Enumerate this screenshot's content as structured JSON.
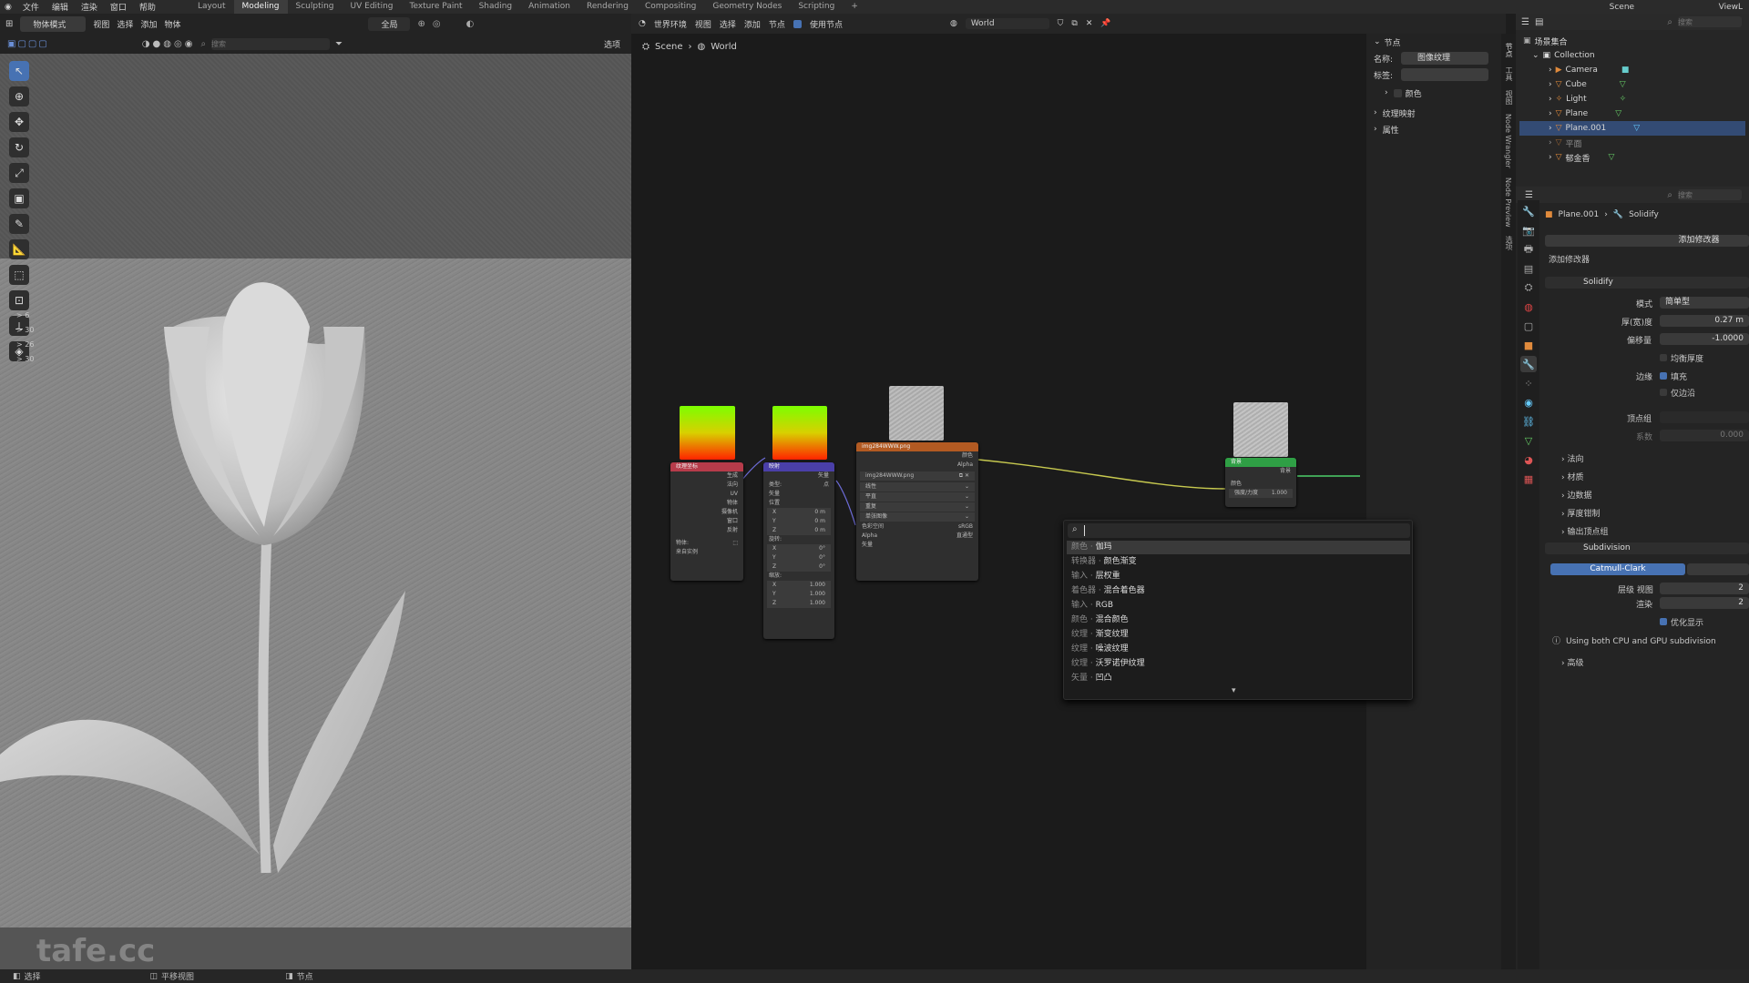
{
  "topbar": {
    "menus": [
      "文件",
      "编辑",
      "渲染",
      "窗口",
      "帮助"
    ],
    "workspaces": [
      "Layout",
      "Modeling",
      "Sculpting",
      "UV Editing",
      "Texture Paint",
      "Shading",
      "Animation",
      "Rendering",
      "Compositing",
      "Geometry Nodes",
      "Scripting"
    ],
    "active_workspace": "Modeling",
    "add_tab": "+",
    "scene_label": "Scene",
    "viewlayer_label": "ViewL"
  },
  "viewport": {
    "mode": "物体模式",
    "menus": [
      "视图",
      "选择",
      "添加",
      "物体"
    ],
    "search_placeholder": "搜索",
    "transform": "全局",
    "options": "选项",
    "collection_rows": [
      "> 6",
      "> 30",
      "> 26",
      "> 30"
    ],
    "watermark": "tafe.cc"
  },
  "node_editor": {
    "world_type": "世界环境",
    "menus": [
      "视图",
      "选择",
      "添加",
      "节点"
    ],
    "use_nodes": "使用节点",
    "world_name": "World",
    "breadcrumb": [
      "Scene",
      "World"
    ],
    "nodes": {
      "texcoord": {
        "title": "纹理坐标",
        "outputs": [
          "生成",
          "法向",
          "UV",
          "物体",
          "摄像机",
          "窗口",
          "反射"
        ],
        "object_label": "物体:",
        "from_instancer": "来自实例"
      },
      "mapping": {
        "title": "映射",
        "output": "矢量",
        "type_label": "类型:",
        "type_value": "点",
        "rows": [
          "矢量",
          "位置",
          "X",
          "Y",
          "Z",
          "旋转:",
          "X",
          "Y",
          "Z",
          "缩放:",
          "X",
          "Y",
          "Z"
        ],
        "pos_values": [
          "0 m",
          "0 m",
          "0 m"
        ],
        "rot_values": [
          "0°",
          "0°",
          "0°"
        ],
        "scale_values": [
          "1.000",
          "1.000",
          "1.000"
        ]
      },
      "image": {
        "title": "img284WWW.png",
        "outputs": [
          "颜色",
          "Alpha"
        ],
        "file": "img284WWW.png",
        "interp": "线性",
        "proj": "平直",
        "ext": "重复",
        "source": "单张图像",
        "colorspace_label": "色彩空间",
        "colorspace": "sRGB",
        "alpha_label": "Alpha",
        "alpha": "直通型",
        "vector": "矢量"
      },
      "background": {
        "title": "背景",
        "output": "背景",
        "input_color": "颜色",
        "strength_label": "强度/力度",
        "strength": "1.000"
      }
    }
  },
  "npanel": {
    "section_node": "节点",
    "name_label": "名称:",
    "name_value": "图像纹理",
    "label_label": "标签:",
    "color_label": "颜色",
    "texture_mapping": "纹理映射",
    "properties": "属性",
    "tabs": [
      "节点",
      "工具",
      "视图",
      "Node Wrangler",
      "Node Preview",
      "选项"
    ]
  },
  "search_popup": {
    "query": "",
    "results": [
      {
        "cat": "颜色 · ",
        "name": "伽玛"
      },
      {
        "cat": "转换器 · ",
        "name": "颜色渐变"
      },
      {
        "cat": "输入 · ",
        "name": "层权重"
      },
      {
        "cat": "着色器 · ",
        "name": "混合着色器"
      },
      {
        "cat": "输入 · ",
        "name": "RGB"
      },
      {
        "cat": "颜色 · ",
        "name": "混合颜色"
      },
      {
        "cat": "纹理 · ",
        "name": "渐变纹理"
      },
      {
        "cat": "纹理 · ",
        "name": "噪波纹理"
      },
      {
        "cat": "纹理 · ",
        "name": "沃罗诺伊纹理"
      },
      {
        "cat": "矢量 · ",
        "name": "凹凸"
      }
    ],
    "more_arrow": "▾"
  },
  "outliner": {
    "search_placeholder": "搜索",
    "root": "场景集合",
    "collection": "Collection",
    "items": [
      "Camera",
      "Cube",
      "Light",
      "Plane",
      "Plane.001",
      "平面",
      "郁金香"
    ],
    "selected": "Plane.001"
  },
  "properties": {
    "search_placeholder": "搜索",
    "object": "Plane.001",
    "modifier_crumb": "Solidify",
    "add_modifier_btn": "添加修改器",
    "add_modifier_label": "添加修改器",
    "solidify": {
      "name": "Solidify",
      "mode_label": "模式",
      "mode": "简单型",
      "thickness_label": "厚(宽)度",
      "thickness": "0.27 m",
      "offset_label": "偏移量",
      "offset": "-1.0000",
      "even_thickness": "均衡厚度",
      "rim_label": "边缘",
      "fill": "填充",
      "only_rim": "仅边沿",
      "vgroup_label": "顶点组",
      "factor_label": "系数",
      "factor": "0.000",
      "sub_panels": [
        "法向",
        "材质",
        "边数据",
        "厚度钳制",
        "输出顶点组"
      ]
    },
    "subdivision": {
      "name": "Subdivision",
      "method": "Catmull-Clark",
      "viewport_label": "层级 视图",
      "viewport": "2",
      "render_label": "渲染",
      "render": "2",
      "optimal": "优化显示",
      "info": "Using both CPU and GPU subdivision",
      "advanced": "高级"
    }
  },
  "statusbar": {
    "select": "选择",
    "pan": "平移视图",
    "node": "节点"
  }
}
